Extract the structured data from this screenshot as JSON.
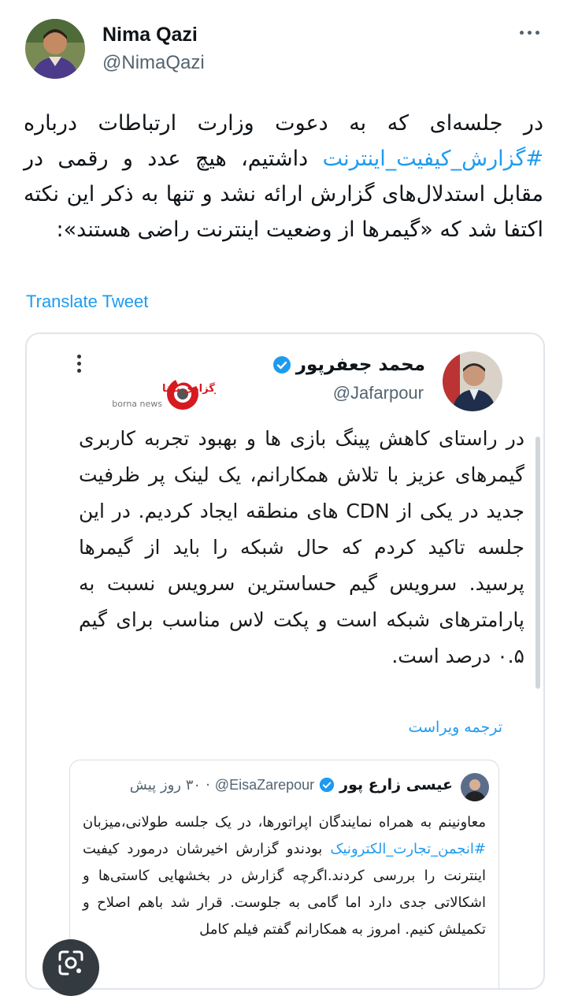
{
  "author": {
    "name": "Nima Qazi",
    "handle": "@NimaQazi"
  },
  "tweet": {
    "line1": "در جلسه‌ای که به دعوت وزارت ارتباطات درباره",
    "hashtag": "#گزارش_کیفیت_اینترنت",
    "line2": " داشتیم، هیچ عدد و رقمی در مقابل استدلال‌های گزارش ارائه نشد و تنها به ذکر این نکته اکتفا شد که «گیمرها از وضعیت اینترنت راضی هستند»:",
    "translate_label": "Translate Tweet"
  },
  "embedded": {
    "name": "محمد جعفرپور",
    "handle": "@Jafarpour",
    "logo_text": "خبرگزاری برنا",
    "logo_sub": "borna news",
    "text": "در راستای کاهش پینگ بازی ها و بهبود تجربه کاربری گیمرهای عزیز با تلاش همکارانم، یک لینک پر ظرفیت جدید در یکی از CDN های منطقه ایجاد کردیم. در این جلسه تاکید کردم که حال شبکه را باید از گیمرها پرسید. سرویس گیم حساسترین سرویس نسبت به پارامترهای شبکه است و پکت لاس مناسب برای گیم ۰.۵ درصد است.",
    "translate_label": "ترجمه ویراست",
    "quoted": {
      "name": "عیسی زارع پور",
      "handle": "@EisaZarepour",
      "time": "۳۰ روز پیش",
      "text_before": "معاونینم به همراه نمایندگان اپراتورها، در یک جلسه طولانی،میزبان ",
      "hashtag": "#انجمن_تجارت_الکترونیک",
      "text_after": " بودندو گزارش اخیرشان درمورد کیفیت اینترنت را بررسی کردند.اگرچه گزارش در بخشهایی کاستی‌ها و اشکالاتی جدی دارد اما گامی به جلوست. قرار شد باهم اصلاح و تکمیلش کنیم. امروز به همکارانم گفتم فیلم کامل"
    }
  },
  "colors": {
    "accent": "#1d9bf0",
    "secondary_text": "#536471"
  },
  "icons": [
    "more-dots-icon",
    "verified-badge-icon",
    "google-lens-icon"
  ]
}
